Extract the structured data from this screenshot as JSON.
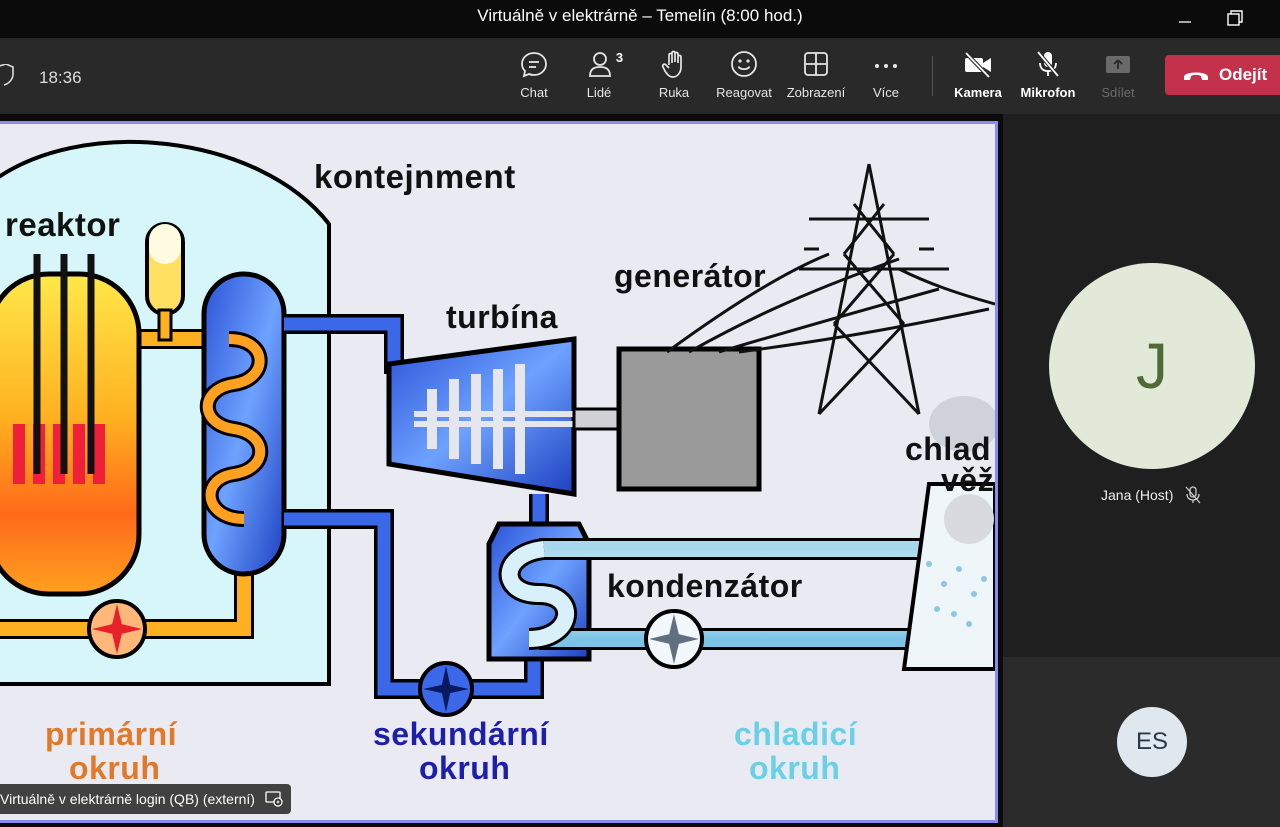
{
  "window": {
    "title": "Virtuálně v elektrárně – Temelín (8:00 hod.)"
  },
  "toolbar": {
    "time": "18:36",
    "chat": "Chat",
    "people": "Lidé",
    "people_count": "3",
    "raise_hand": "Ruka",
    "react": "Reagovat",
    "view": "Zobrazení",
    "more": "Více",
    "camera": "Kamera",
    "mic": "Mikrofon",
    "share": "Sdílet",
    "leave": "Odejít",
    "leave_color": "#c4314b"
  },
  "shared_content": {
    "labels": {
      "containment": "kontejnment",
      "reactor": "reaktor",
      "generator": "generátor",
      "turbine": "turbína",
      "cooling_tower_1": "chlad",
      "cooling_tower_2": "věž",
      "condenser": "kondenzátor",
      "primary_1": "primární",
      "primary_2": "okruh",
      "secondary_1": "sekundární",
      "secondary_2": "okruh",
      "cooling_1": "chladicí",
      "cooling_2": "okruh"
    },
    "colors": {
      "primary": "#e8822a",
      "secondary": "#1d1fa8",
      "cooling": "#6ad0e8"
    },
    "presenter": "Virtuálně v elektrárně login (QB) (externí)"
  },
  "participants": [
    {
      "initial": "J",
      "name": "Jana (Host)",
      "muted": true
    },
    {
      "initials": "ES"
    }
  ]
}
